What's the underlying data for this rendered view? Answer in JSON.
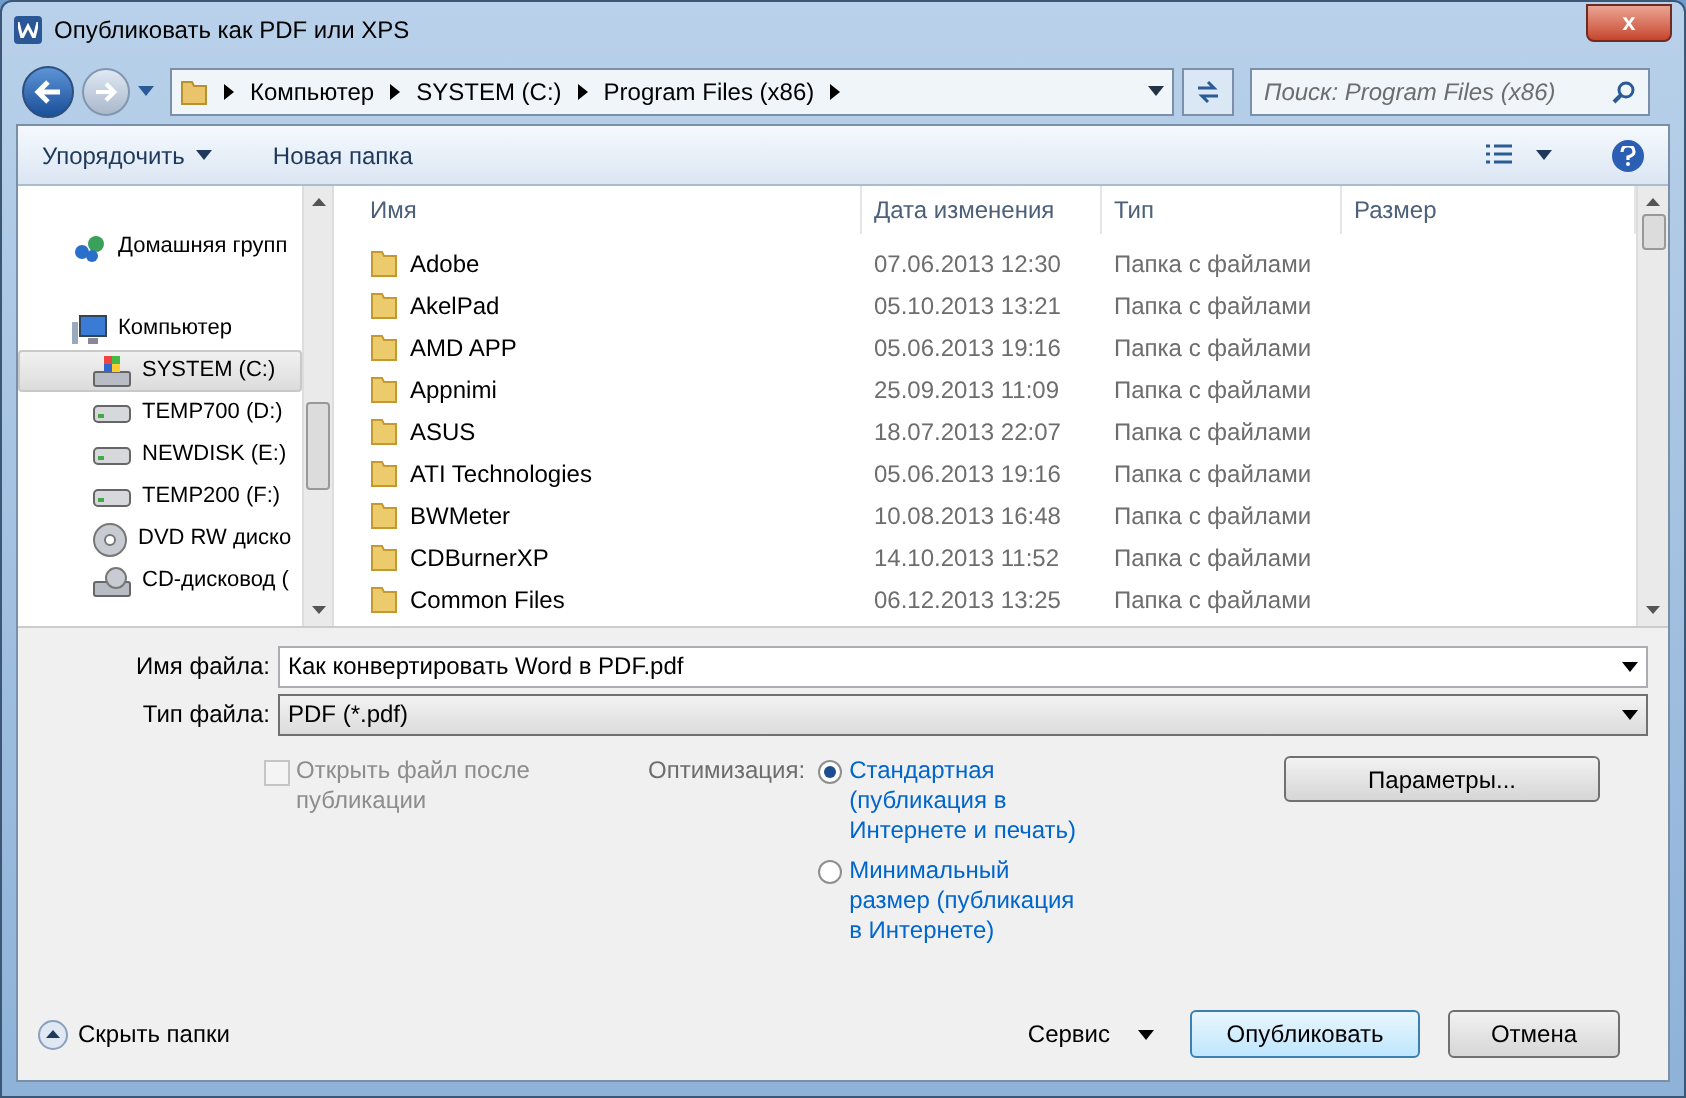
{
  "window": {
    "title": "Опубликовать как PDF или XPS",
    "close": "x"
  },
  "address": {
    "segments": [
      "Компьютер",
      "SYSTEM (C:)",
      "Program Files (x86)"
    ]
  },
  "search": {
    "placeholder": "Поиск: Program Files (x86)"
  },
  "toolbar": {
    "organize": "Упорядочить",
    "new_folder": "Новая папка"
  },
  "sidebar": {
    "items": [
      {
        "label": "Домашняя групп",
        "kind": "homegroup",
        "selected": false
      },
      {
        "label": "Компьютер",
        "kind": "computer",
        "selected": false
      },
      {
        "label": "SYSTEM (C:)",
        "kind": "system",
        "selected": true
      },
      {
        "label": "TEMP700 (D:)",
        "kind": "drive",
        "selected": false
      },
      {
        "label": "NEWDISK (E:)",
        "kind": "drive",
        "selected": false
      },
      {
        "label": "TEMP200 (F:)",
        "kind": "drive",
        "selected": false
      },
      {
        "label": "DVD RW диско",
        "kind": "dvd",
        "selected": false
      },
      {
        "label": "CD-дисковод (",
        "kind": "cd",
        "selected": false
      }
    ]
  },
  "table": {
    "columns": [
      "Имя",
      "Дата изменения",
      "Тип",
      "Размер"
    ],
    "rows": [
      [
        "Adobe",
        "07.06.2013 12:30",
        "Папка с файлами"
      ],
      [
        "AkelPad",
        "05.10.2013 13:21",
        "Папка с файлами"
      ],
      [
        "AMD APP",
        "05.06.2013 19:16",
        "Папка с файлами"
      ],
      [
        "Appnimi",
        "25.09.2013 11:09",
        "Папка с файлами"
      ],
      [
        "ASUS",
        "18.07.2013 22:07",
        "Папка с файлами"
      ],
      [
        "ATI Technologies",
        "05.06.2013 19:16",
        "Папка с файлами"
      ],
      [
        "BWMeter",
        "10.08.2013 16:48",
        "Папка с файлами"
      ],
      [
        "CDBurnerXP",
        "14.10.2013 11:52",
        "Папка с файлами"
      ],
      [
        "Common Files",
        "06.12.2013 13:25",
        "Папка с файлами"
      ]
    ]
  },
  "file_name": {
    "label": "Имя файла:",
    "value": "Как конвертировать Word в PDF.pdf"
  },
  "file_type": {
    "label": "Тип файла:",
    "value": "PDF (*.pdf)"
  },
  "open_after": {
    "label": "Открыть файл после публикации",
    "checked": false,
    "disabled": true
  },
  "optimization": {
    "label": "Оптимизация:",
    "options": [
      {
        "label": "Стандартная (публикация в Интернете и печать)",
        "selected": true
      },
      {
        "label": "Минимальный размер (публикация в Интернете)",
        "selected": false
      }
    ]
  },
  "options_button": "Параметры...",
  "hide_folders": "Скрыть папки",
  "tools": "Сервис",
  "publish_button": "Опубликовать",
  "cancel_button": "Отмена"
}
